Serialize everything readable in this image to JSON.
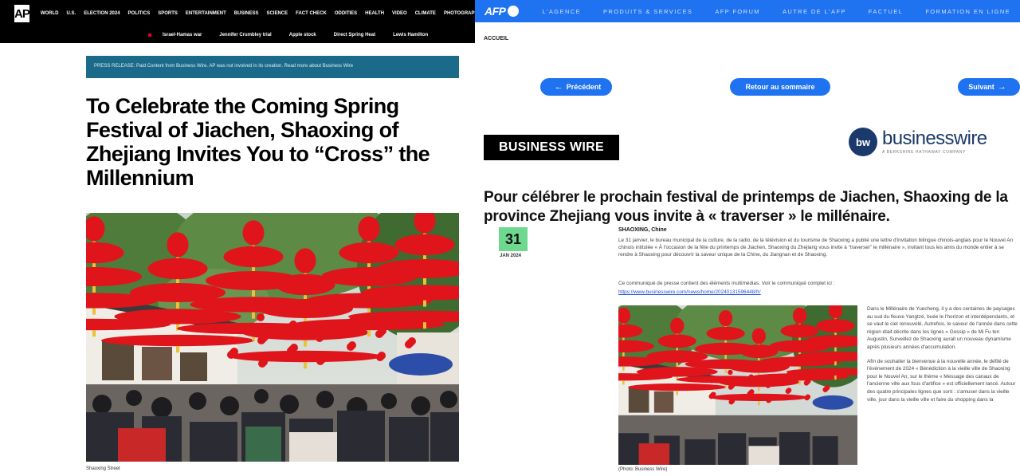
{
  "ap": {
    "logo": "AP",
    "nav_links": [
      "WORLD",
      "U.S.",
      "ELECTION 2024",
      "POLITICS",
      "SPORTS",
      "ENTERTAINMENT",
      "BUSINESS",
      "SCIENCE",
      "FACT CHECK",
      "ODDITIES",
      "HEALTH",
      "VIDEO",
      "CLIMATE",
      "PHOTOGRAPHY"
    ],
    "trending": [
      "Israel-Hamas war",
      "Jennifer Crumbley trial",
      "Apple stock",
      "Direct Spring Heat",
      "Lewis Hamilton"
    ],
    "banner": "PRESS RELEASE: Paid Content from Business Wire. AP was not involved in its creation. Read more about Business Wire",
    "headline": "To Celebrate the Coming Spring Festival of Jiachen, Shaoxing of Zhejiang Invites You to “Cross” the Millennium",
    "photo_caption": "Shaoxing Street"
  },
  "afp": {
    "logo": "AFP",
    "nav_links": [
      "L'AGENCE",
      "PRODUITS & SERVICES",
      "AFP FORUM",
      "AUTRE DE L'AFP",
      "FACTUEL",
      "FORMATION EN LIGNE"
    ],
    "breadcrumb": "ACCUEIL",
    "btn_prev": "Précédent",
    "btn_summary": "Retour au sommaire",
    "btn_next": "Suivant",
    "badge": "BUSINESS WIRE",
    "bw_logo_mark": "bw",
    "bw_logo_name": "businesswire",
    "bw_logo_sub": "A BERKSHIRE HATHAWAY COMPANY",
    "headline": "Pour célébrer le prochain festival de printemps de Jiachen, Shaoxing de la province Zhejiang vous invite à « traverser » le millénaire.",
    "date_day": "31",
    "date_month": "JAN 2024",
    "dateline": "SHAOXING, Chine",
    "para1": "Le 31 janvier, le bureau municipal de la culture, de la radio, de la télévision et du tourisme de Shaoxing a publié une lettre d'invitation bilingue chinois-anglais pour le Nouvel An chinois intitulée « À l'occasion de la fête du printemps de Jiachen, Shaoxing du Zhejiang vous invite à “traverser” le millénaire », invitant tous les amis du monde entier à se rendre à Shaoxing pour découvrir la saveur unique de la Chine, du Jiangnan et de Shaoxing.",
    "para2": "Ce communiqué de presse contient des éléments multimédias. Voir le communiqué complet ici :",
    "link": "https://www.businesswire.com/news/home/20240131596448/fr/",
    "photo_caption": "(Photo: Business Wire)",
    "side_p1": "Dans le Millénaire de Yuecheng, il y a des centaines de paysages au sud du fleuve Yangtzé, buée le l'horizon et interdépendants, et se vaut le ciel renouvelé. Autrefois, le saveur de l'année dans cette région était décrite dans les lignes « Gossip » de Mi Fu ten Augustin, Surveillez de Shaoxing aurait un nouveau dynamisme après plusieurs années d'accumulation.",
    "side_p2": "Afin de souhaiter la bienvenue à la nouvelle année, le défilé de l'événement de 2024 « Bénédiction à la vieille ville de Shaoxing pour le Nouvel An, sur le thème « Message des canaux de l'ancienne ville aux fous d'artifice » est officiellement lancé. Autour des quatre principales lignes que sont : s'amuser dans la vieille ville, jour dans la vieille ville et faire du shopping dans la"
  },
  "colors": {
    "ap_nav": "#000000",
    "ap_banner": "#1c6a8a",
    "afp_blue": "#1f72f0",
    "afp_date_green": "#6ed88f",
    "bw_navy": "#1b3a6b",
    "lantern_red": "#e0141b"
  }
}
